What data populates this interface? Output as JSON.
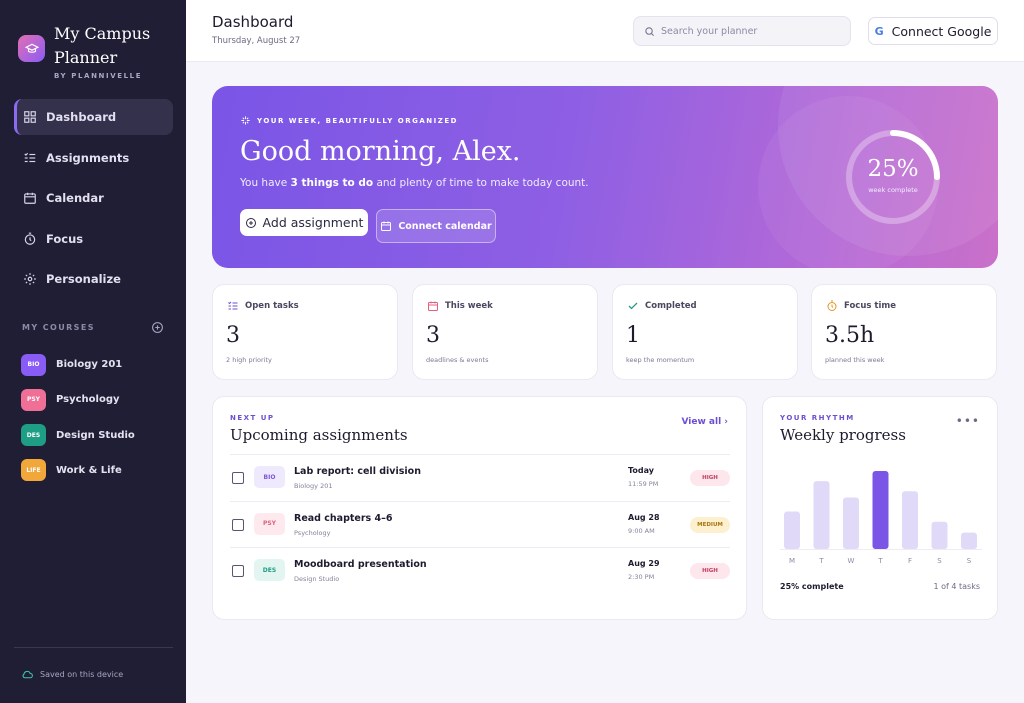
{
  "sidebar": {
    "brand_title": "My Campus Planner",
    "brand_sub": "BY PLANNIVELLE",
    "nav": [
      {
        "label": "Dashboard",
        "icon": "grid-icon",
        "active": true
      },
      {
        "label": "Assignments",
        "icon": "checklist-icon"
      },
      {
        "label": "Calendar",
        "icon": "calendar-icon"
      },
      {
        "label": "Focus",
        "icon": "timer-icon"
      },
      {
        "label": "Personalize",
        "icon": "gear-icon"
      }
    ],
    "courses_label": "MY COURSES",
    "courses": [
      {
        "code": "BIO",
        "name": "Biology 201",
        "color": "#8a5cf6"
      },
      {
        "code": "PSY",
        "name": "Psychology",
        "color": "#ef6f96"
      },
      {
        "code": "DES",
        "name": "Design Studio",
        "color": "#1f9e86"
      },
      {
        "code": "LIFE",
        "name": "Work & Life",
        "color": "#f2a73b"
      }
    ],
    "saved_text": "Saved on this device"
  },
  "header": {
    "title": "Dashboard",
    "date": "Thursday, August 27",
    "search_placeholder": "Search your planner",
    "connect_google": "Connect Google",
    "google_letter": "G"
  },
  "hero": {
    "eyebrow": "YOUR WEEK, BEAUTIFULLY ORGANIZED",
    "greeting": "Good morning, Alex.",
    "text_pre": "You have ",
    "text_bold": "3 things to do",
    "text_post": " and plenty of time to make today count.",
    "add_button": "Add assignment",
    "calendar_button": "Connect calendar",
    "progress_pct": "25%",
    "progress_value": 0.25,
    "progress_label": "week complete"
  },
  "stats": [
    {
      "label": "Open tasks",
      "value": "3",
      "sub": "2 high priority",
      "icon": "checklist-icon",
      "color": "#6c4fd0"
    },
    {
      "label": "This week",
      "value": "3",
      "sub": "deadlines & events",
      "icon": "calendar-icon",
      "color": "#e0607f"
    },
    {
      "label": "Completed",
      "value": "1",
      "sub": "keep the momentum",
      "icon": "check-icon",
      "color": "#1f9e86"
    },
    {
      "label": "Focus time",
      "value": "3.5h",
      "sub": "planned this week",
      "icon": "timer-icon",
      "color": "#e0962c"
    }
  ],
  "upcoming": {
    "eyebrow": "NEXT UP",
    "title": "Upcoming assignments",
    "view_all": "View all ›",
    "tasks": [
      {
        "chip": "BIO",
        "name": "Lab report: cell division",
        "course": "Biology 201",
        "due": "Today",
        "time": "11:59 PM",
        "priority": "HIGH"
      },
      {
        "chip": "PSY",
        "name": "Read chapters 4–6",
        "course": "Psychology",
        "due": "Aug 28",
        "time": "9:00 AM",
        "priority": "MEDIUM"
      },
      {
        "chip": "DES",
        "name": "Moodboard presentation",
        "course": "Design Studio",
        "due": "Aug 29",
        "time": "2:30 PM",
        "priority": "HIGH"
      }
    ]
  },
  "weekly": {
    "eyebrow": "YOUR RHYTHM",
    "title": "Weekly progress",
    "more": "•••",
    "footer_left": "25% complete",
    "footer_right": "1 of 4 tasks"
  },
  "chart_data": {
    "type": "bar",
    "categories": [
      "M",
      "T",
      "W",
      "T",
      "F",
      "S",
      "S"
    ],
    "values": [
      48,
      87,
      66,
      100,
      74,
      35,
      21
    ],
    "highlight_index": 3,
    "ylim": [
      0,
      100
    ],
    "grid": false
  }
}
